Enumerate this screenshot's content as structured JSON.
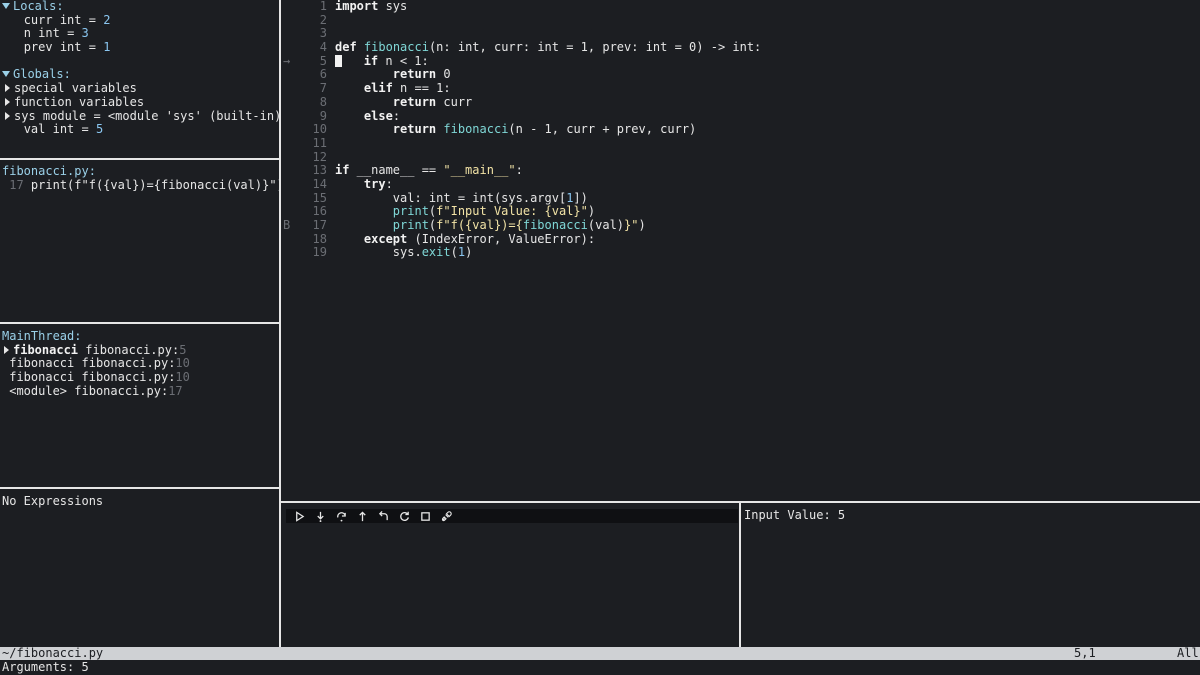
{
  "variables": {
    "locals_title": "Locals:",
    "locals": [
      {
        "name": "curr",
        "type": "int",
        "value": "2"
      },
      {
        "name": "n",
        "type": "int",
        "value": "3"
      },
      {
        "name": "prev",
        "type": "int",
        "value": "1"
      }
    ],
    "globals_title": "Globals:",
    "globals_groups": [
      "special variables",
      "function variables",
      "sys module = <module 'sys' (built-in)"
    ],
    "globals_val": {
      "name": "val",
      "type": "int",
      "value": "5"
    }
  },
  "breakpoints": {
    "file": "fibonacci.py:",
    "line_no": "17",
    "code": "print(f\"f({val})={fibonacci(val)}\")"
  },
  "callstack": {
    "thread": "MainThread:",
    "frames": [
      {
        "func": "fibonacci",
        "file": "fibonacci.py:",
        "line": "5"
      },
      {
        "func": "fibonacci",
        "file": "fibonacci.py:",
        "line": "10"
      },
      {
        "func": "fibonacci",
        "file": "fibonacci.py:",
        "line": "10"
      },
      {
        "func": "<module>",
        "file": "fibonacci.py:",
        "line": "17"
      }
    ]
  },
  "watches": {
    "empty_text": "No Expressions"
  },
  "editor": {
    "current_line": "5",
    "breakpoint_line": "17"
  },
  "console": {
    "output": "Input Value: 5"
  },
  "toolbar": {
    "icons": [
      "play-icon",
      "step-into-icon",
      "step-over-icon",
      "step-out-icon",
      "step-back-icon",
      "restart-icon",
      "stop-icon",
      "disconnect-icon"
    ]
  },
  "statusbar": {
    "path": "~/fibonacci.py",
    "position": "5,1",
    "scroll": "All"
  },
  "cmdline": {
    "text": "Arguments: 5"
  },
  "colors": {
    "background": "#1c1e22",
    "accent": "#9ad0e8",
    "number": "#8ac6f0",
    "function": "#7fd7d6",
    "string": "#f2e3a6",
    "separator": "#e6e6e6"
  }
}
